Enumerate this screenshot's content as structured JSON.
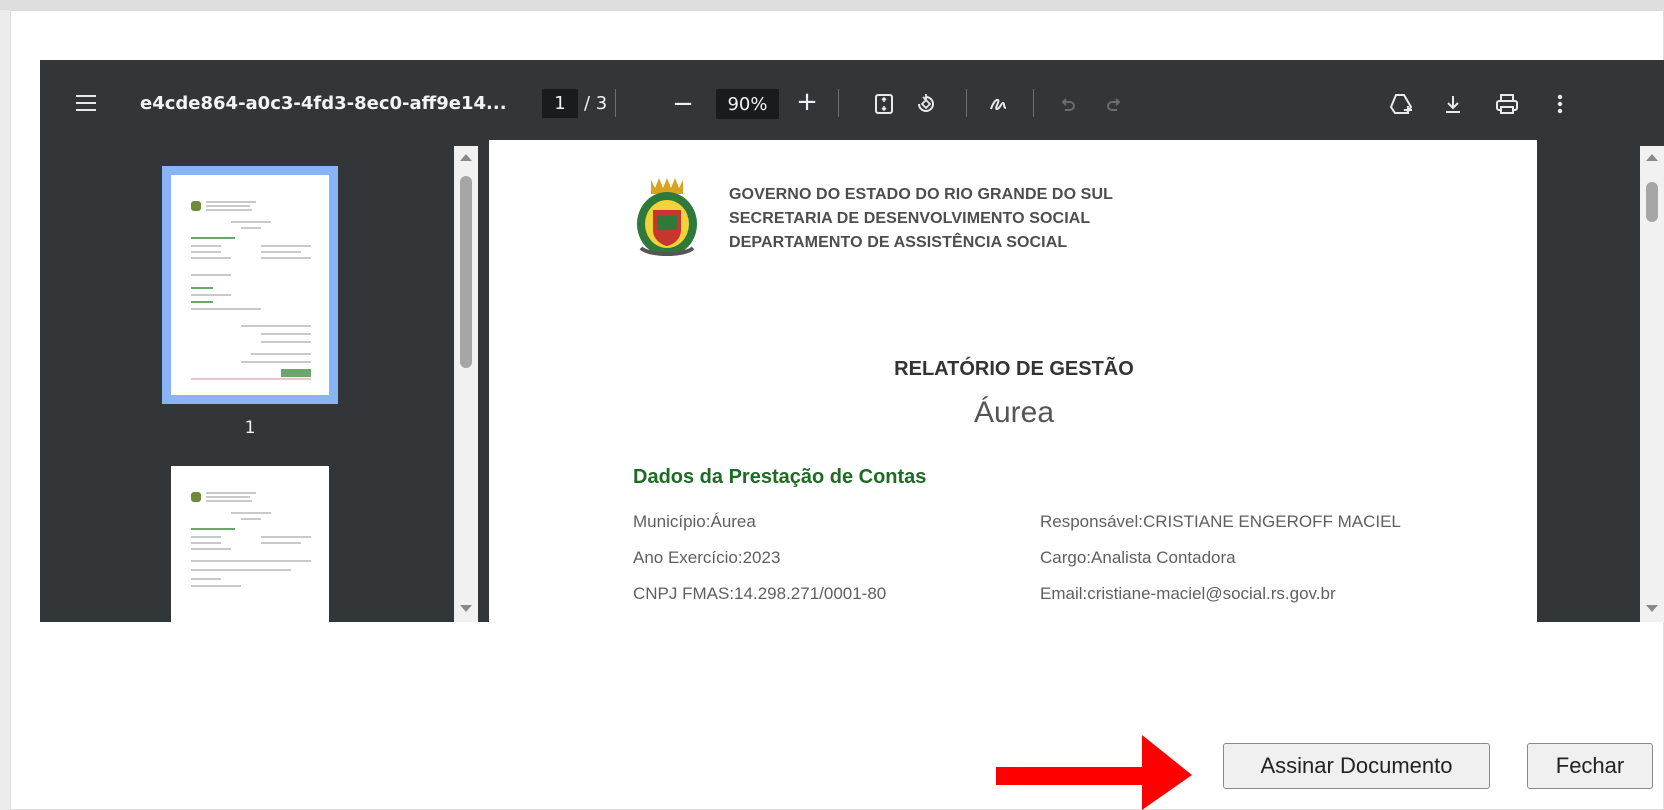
{
  "viewer": {
    "file_name": "e4cde864-a0c3-4fd3-8ec0-aff9e14...",
    "current_page": "1",
    "page_separator": "/ 3",
    "zoom": "90%",
    "zoom_out_label": "−",
    "zoom_in_label": "+",
    "thumbnail_page_label": "1"
  },
  "document": {
    "header_lines": [
      "GOVERNO DO ESTADO DO RIO GRANDE DO SUL",
      "SECRETARIA DE DESENVOLVIMENTO SOCIAL",
      "DEPARTAMENTO DE ASSISTÊNCIA SOCIAL"
    ],
    "report_title": "RELATÓRIO DE GESTÃO",
    "city": "Áurea",
    "section_title": "Dados da Prestação de Contas",
    "left_fields": [
      "Município:Áurea",
      "Ano Exercício:2023",
      "CNPJ FMAS:14.298.271/0001-80"
    ],
    "right_fields": [
      "Responsável:CRISTIANE ENGEROFF MACIEL",
      "Cargo:Analista Contadora",
      "Email:cristiane-maciel@social.rs.gov.br"
    ]
  },
  "actions": {
    "sign_label": "Assinar Documento",
    "close_label": "Fechar"
  },
  "colors": {
    "toolbar_bg": "#323639",
    "section_green": "#1e6b24",
    "thumb_highlight": "#8ab4f8",
    "arrow_red": "#ff0000"
  },
  "icons": [
    "menu-icon",
    "fit-page-icon",
    "rotate-icon",
    "annotate-icon",
    "undo-icon",
    "redo-icon",
    "add-to-drive-icon",
    "download-icon",
    "print-icon",
    "more-options-icon"
  ]
}
